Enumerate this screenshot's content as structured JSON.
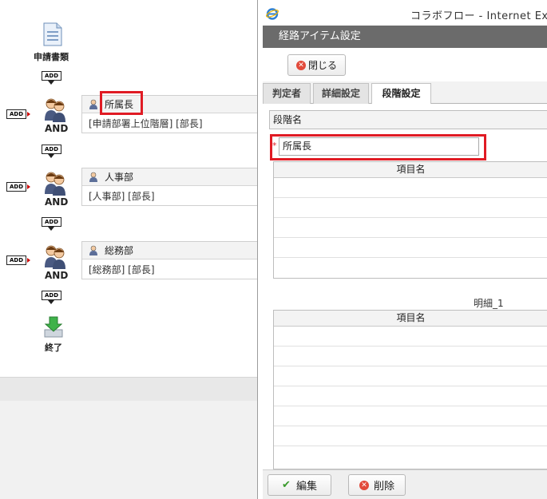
{
  "flow": {
    "start_label": "申請書類",
    "add_label": "ADD",
    "and_label": "AND",
    "end_label": "終了",
    "nodes": [
      {
        "title": "所属長",
        "body": "[申請部署上位階層] [部長]"
      },
      {
        "title": "人事部",
        "body": "[人事部] [部長]"
      },
      {
        "title": "総務部",
        "body": "[総務部] [部長]"
      }
    ]
  },
  "window": {
    "title": "コラボフロー - Internet Exp"
  },
  "dialog": {
    "header": "経路アイテム設定",
    "close_label": "閉じる",
    "tabs": [
      {
        "label": "判定者",
        "active": false
      },
      {
        "label": "詳細設定",
        "active": false
      },
      {
        "label": "段階設定",
        "active": true
      }
    ],
    "stage_name_label": "段階名",
    "required_mark": "*",
    "stage_name_value": "所属長",
    "grid1_header": "項目名",
    "detail_caption": "明細_1",
    "grid2_header": "項目名",
    "edit_label": "編集",
    "delete_label": "削除"
  },
  "colors": {
    "highlight": "#e01b24",
    "dialog_header": "#6b6b6b",
    "required": "#e01b24"
  }
}
